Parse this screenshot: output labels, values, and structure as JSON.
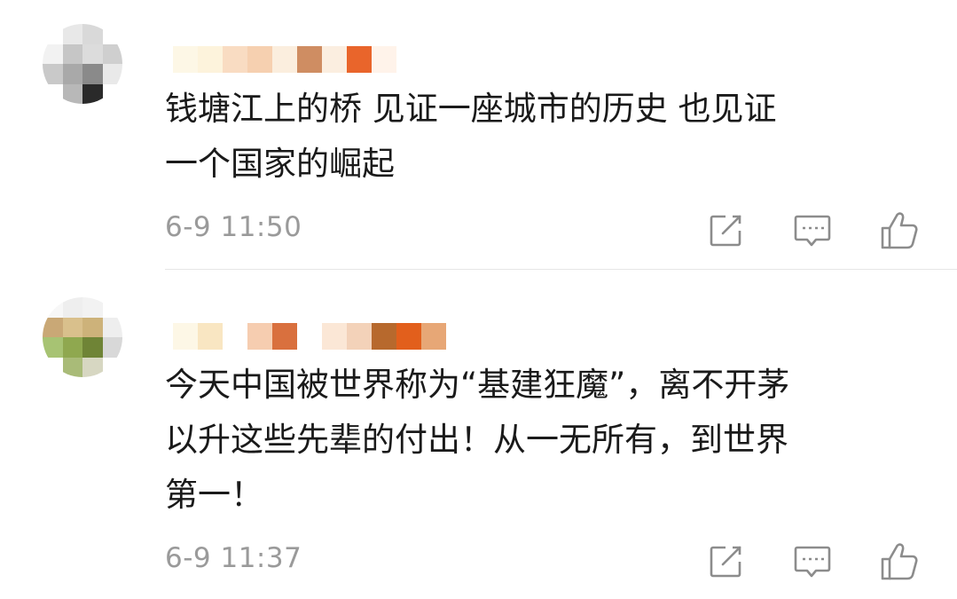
{
  "comments": [
    {
      "text": "钱塘江上的桥 见证一座城市的历史 也见证\n一个国家的崛起",
      "time": "6-9 11:50",
      "avatar_pixels": [
        "#ffffff",
        "#e8e8e8",
        "#d9d9d9",
        "#ffffff",
        "#f2f2f2",
        "#c6c6c6",
        "#dcdcdc",
        "#cfcfcf",
        "#c9c9c9",
        "#a9a9a9",
        "#8a8a8a",
        "#e9e9e9",
        "#ffffff",
        "#b8b8b8",
        "#2a2a2a",
        "#ffffff"
      ],
      "name_pixels": [
        "#fdf7e6",
        "#fdf3dc",
        "#f9dcc2",
        "#f6d0b0",
        "#fbeede",
        "#cf8d62",
        "#fbeee0",
        "#e9652b",
        "#fff3ea"
      ]
    },
    {
      "text": "今天中国被世界称为“基建狂魔”，离不开茅\n以升这些先辈的付出！从一无所有，到世界\n第一！",
      "time": "6-9 11:37",
      "avatar_pixels": [
        "#f7f7f7",
        "#eeeeee",
        "#f2f2f2",
        "#ffffff",
        "#c9a876",
        "#d9c08c",
        "#cdb27a",
        "#eeeeee",
        "#a7c373",
        "#8fa84f",
        "#6f8436",
        "#d8d8d8",
        "#ffffff",
        "#a9bb78",
        "#d7d7c2",
        "#ffffff"
      ],
      "name_pixels": [
        "#fdf7e6",
        "#f9e6c2",
        "#ffffff",
        "#f6cdb0",
        "#d9703e",
        "#ffffff",
        "#fbe7d6",
        "#f3d2b9",
        "#b7692d",
        "#e25f1c",
        "#e7a776"
      ]
    }
  ],
  "icons": {
    "share": "share-edit-icon",
    "reply": "comment-icon",
    "like": "thumbs-up-icon"
  },
  "colors": {
    "text": "#1a1a1a",
    "timestamp": "#9a9a9a",
    "icon": "#8c8c8c",
    "divider": "#e6e6e6"
  }
}
